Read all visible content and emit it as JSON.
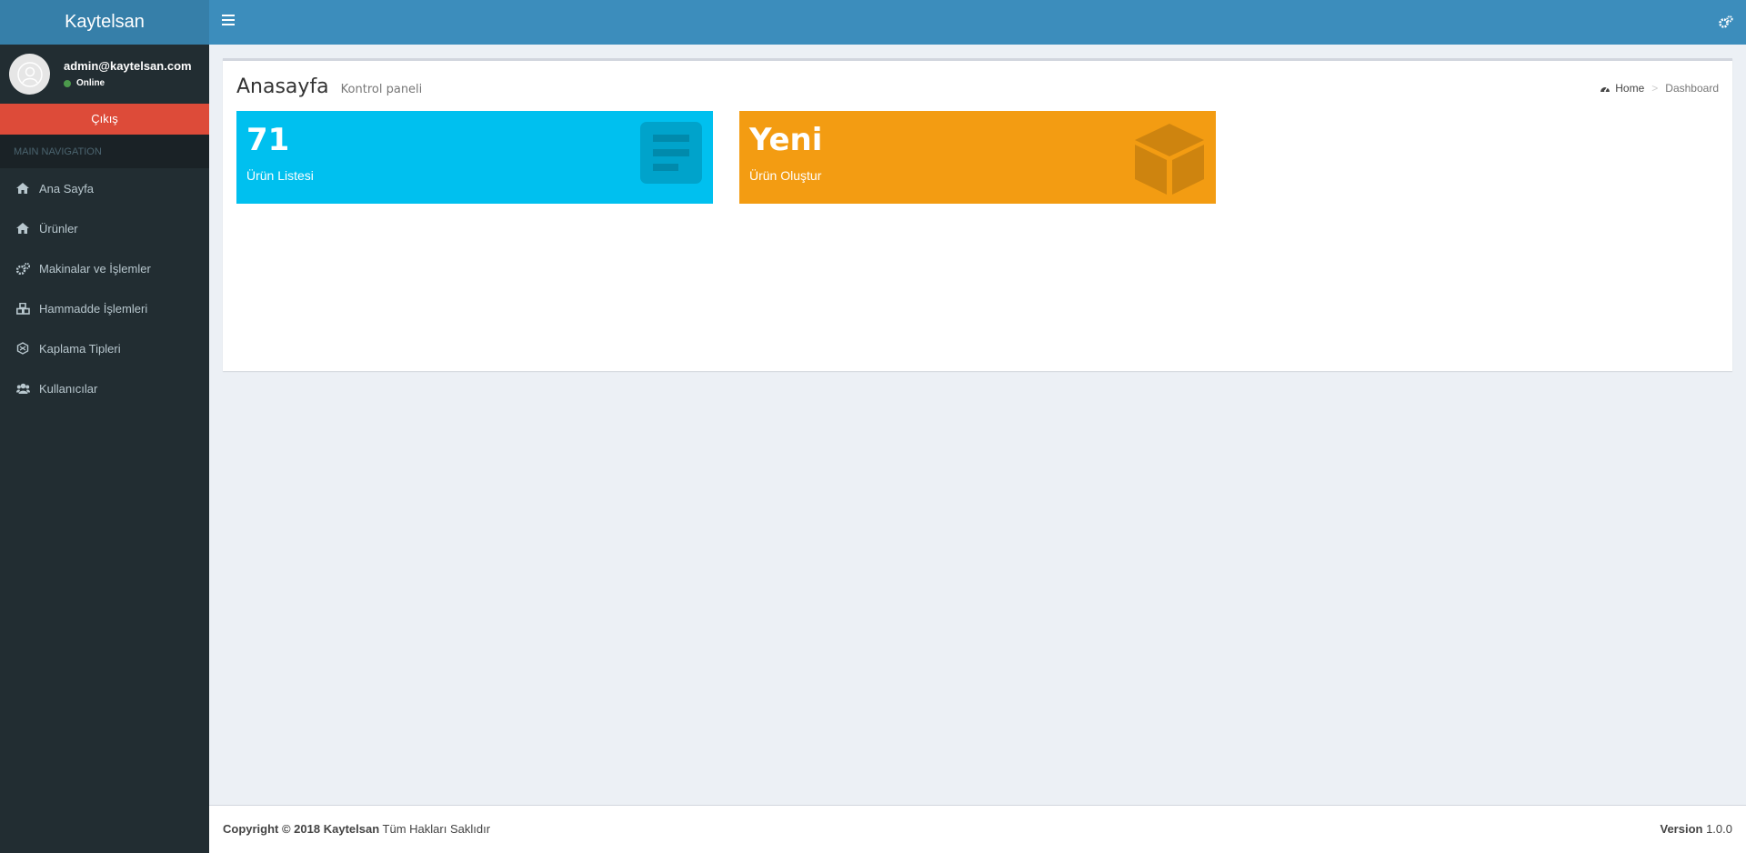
{
  "app": {
    "logo": "Kaytelsan"
  },
  "user": {
    "email": "admin@kaytelsan.com",
    "status": "Online",
    "logout_label": "Çıkış"
  },
  "sidebar": {
    "header": "MAIN NAVIGATION",
    "items": [
      {
        "label": "Ana Sayfa",
        "icon": "home-icon"
      },
      {
        "label": "Ürünler",
        "icon": "home-icon"
      },
      {
        "label": "Makinalar ve İşlemler",
        "icon": "cogs-icon"
      },
      {
        "label": "Hammadde İşlemleri",
        "icon": "cubes-icon"
      },
      {
        "label": "Kaplama Tipleri",
        "icon": "modx-icon"
      },
      {
        "label": "Kullanıcılar",
        "icon": "users-icon"
      }
    ]
  },
  "page": {
    "title": "Anasayfa",
    "subtitle": "Kontrol paneli",
    "breadcrumb": {
      "home": "Home",
      "current": "Dashboard"
    }
  },
  "tiles": [
    {
      "value": "71",
      "label": "Ürün Listesi",
      "color": "#00c0ef",
      "icon": "list-icon"
    },
    {
      "value": "Yeni",
      "label": "Ürün Oluştur",
      "color": "#f39c12",
      "icon": "cube-icon"
    }
  ],
  "footer": {
    "copyright_prefix": "Copyright © 2018",
    "brand": "Kaytelsan",
    "rights": "Tüm Hakları Saklıdır",
    "version_label": "Version",
    "version": "1.0.0"
  },
  "colors": {
    "topbar": "#3c8dbc",
    "logo_bg": "#367fa9",
    "sidebar": "#222d32",
    "logout": "#dd4b39"
  }
}
